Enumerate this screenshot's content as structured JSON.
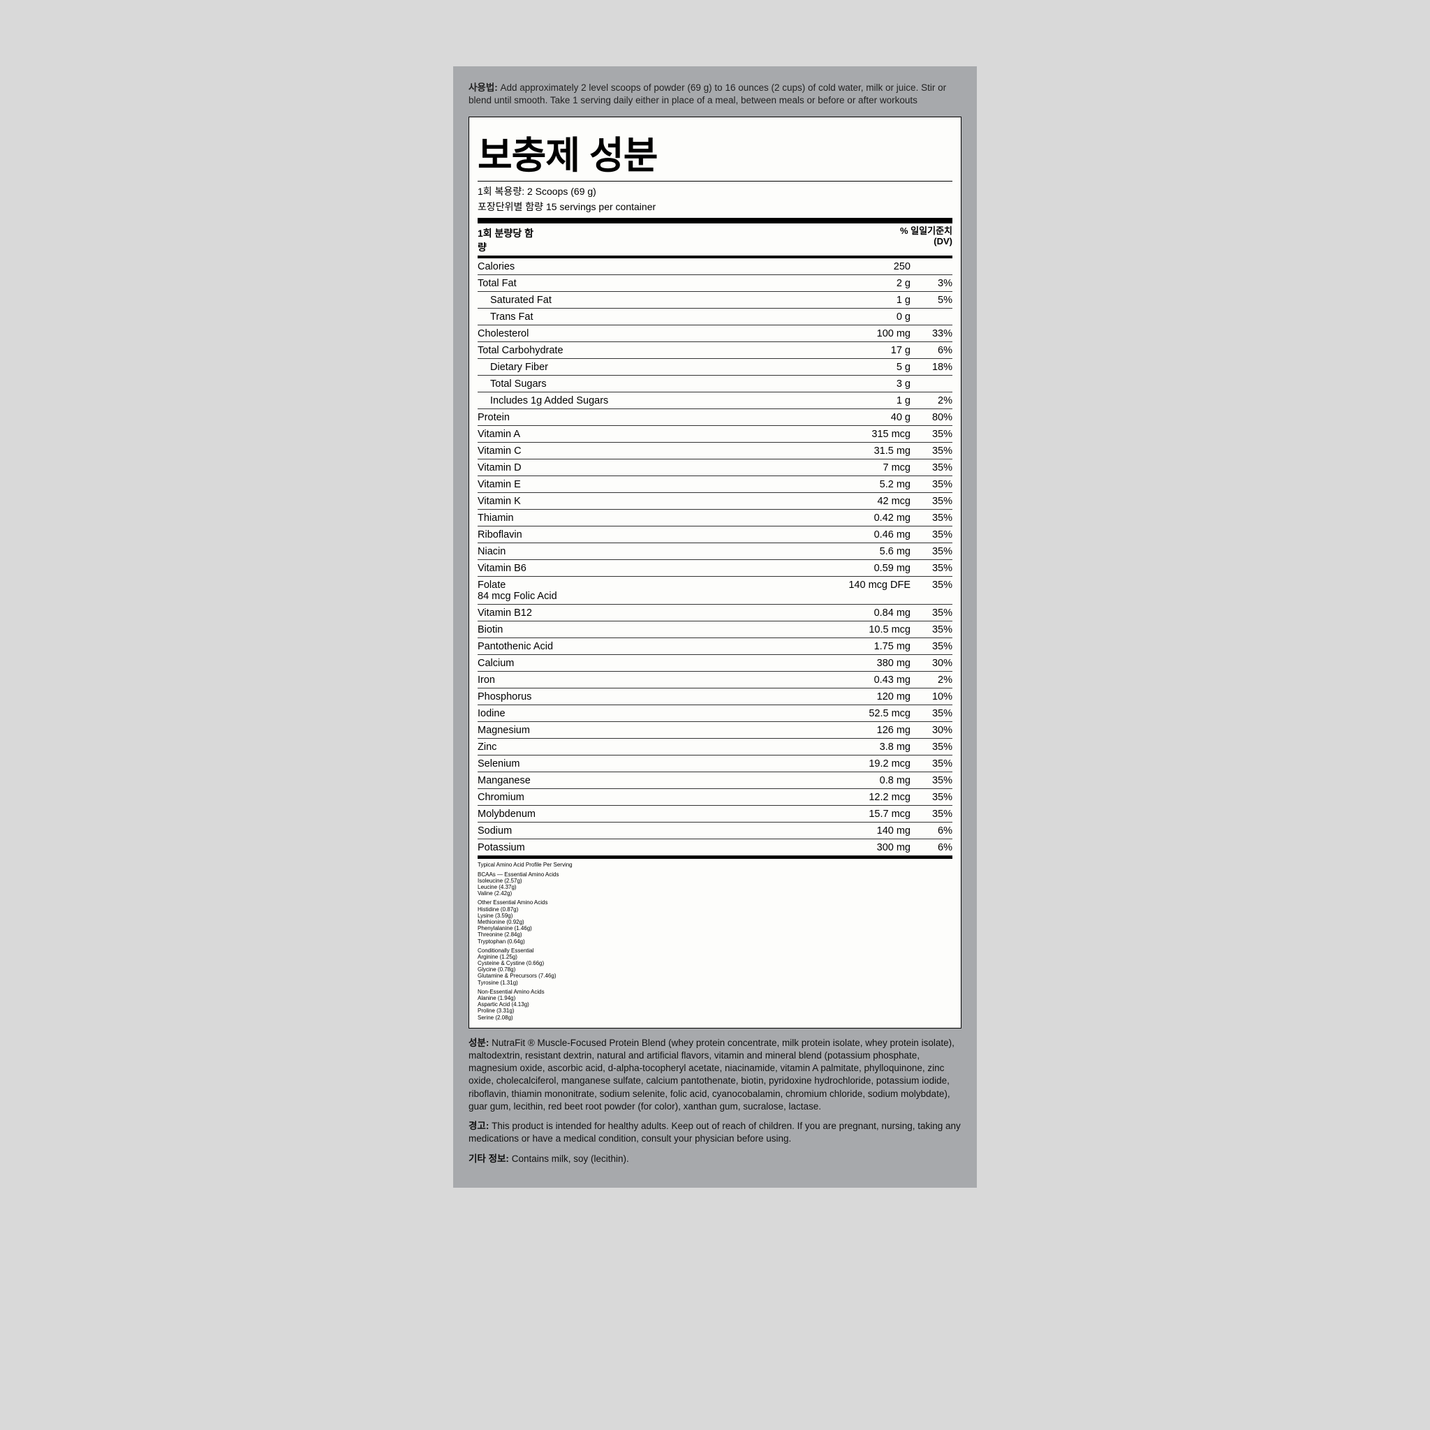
{
  "usage": {
    "label": "사용법:",
    "text": " Add approximately 2 level scoops of powder (69 g) to 16 ounces (2 cups) of cold water, milk or juice. Stir or blend until smooth. Take 1 serving daily either in place of a meal, between meals or before or after workouts"
  },
  "title": "보충제 성분",
  "serving_size_label": "1회 복용량: ",
  "serving_size": "2 Scoops (69 g)",
  "servings_per_label": "포장단위별 함량 ",
  "servings_per": "15 servings per container",
  "col_left": "1회 분량당 함량",
  "col_right": "% 일일기준치 (DV)",
  "rows": [
    {
      "name": "Calories",
      "amt": "250",
      "dv": ""
    },
    {
      "name": "Total Fat",
      "amt": "2 g",
      "dv": "3%"
    },
    {
      "name": "Saturated Fat",
      "amt": "1 g",
      "dv": "5%",
      "sub": true
    },
    {
      "name": "Trans Fat",
      "amt": "0 g",
      "dv": "",
      "sub": true
    },
    {
      "name": "Cholesterol",
      "amt": "100 mg",
      "dv": "33%"
    },
    {
      "name": "Total Carbohydrate",
      "amt": "17 g",
      "dv": "6%"
    },
    {
      "name": "Dietary Fiber",
      "amt": "5 g",
      "dv": "18%",
      "sub": true
    },
    {
      "name": "Total Sugars",
      "amt": "3 g",
      "dv": "",
      "sub": true
    },
    {
      "name": "Includes 1g Added Sugars",
      "amt": "1 g",
      "dv": "2%",
      "sub": true
    },
    {
      "name": "Protein",
      "amt": "40 g",
      "dv": "80%"
    },
    {
      "name": "Vitamin A",
      "amt": "315 mcg",
      "dv": "35%"
    },
    {
      "name": "Vitamin C",
      "amt": "31.5 mg",
      "dv": "35%"
    },
    {
      "name": "Vitamin D",
      "amt": "7 mcg",
      "dv": "35%"
    },
    {
      "name": "Vitamin E",
      "amt": "5.2 mg",
      "dv": "35%"
    },
    {
      "name": "Vitamin K",
      "amt": "42 mcg",
      "dv": "35%"
    },
    {
      "name": "Thiamin",
      "amt": "0.42 mg",
      "dv": "35%"
    },
    {
      "name": "Riboflavin",
      "amt": "0.46 mg",
      "dv": "35%"
    },
    {
      "name": "Niacin",
      "amt": "5.6 mg",
      "dv": "35%"
    },
    {
      "name": "Vitamin B6",
      "amt": "0.59 mg",
      "dv": "35%"
    },
    {
      "name": "Folate\n84 mcg Folic Acid",
      "amt": "140 mcg DFE",
      "dv": "35%"
    },
    {
      "name": "Vitamin B12",
      "amt": "0.84 mg",
      "dv": "35%"
    },
    {
      "name": "Biotin",
      "amt": "10.5 mcg",
      "dv": "35%"
    },
    {
      "name": "Pantothenic Acid",
      "amt": "1.75 mg",
      "dv": "35%"
    },
    {
      "name": "Calcium",
      "amt": "380 mg",
      "dv": "30%"
    },
    {
      "name": "Iron",
      "amt": "0.43 mg",
      "dv": "2%"
    },
    {
      "name": "Phosphorus",
      "amt": "120 mg",
      "dv": "10%"
    },
    {
      "name": "Iodine",
      "amt": "52.5 mcg",
      "dv": "35%"
    },
    {
      "name": "Magnesium",
      "amt": "126 mg",
      "dv": "30%"
    },
    {
      "name": "Zinc",
      "amt": "3.8 mg",
      "dv": "35%"
    },
    {
      "name": "Selenium",
      "amt": "19.2 mcg",
      "dv": "35%"
    },
    {
      "name": "Manganese",
      "amt": "0.8 mg",
      "dv": "35%"
    },
    {
      "name": "Chromium",
      "amt": "12.2 mcg",
      "dv": "35%"
    },
    {
      "name": "Molybdenum",
      "amt": "15.7 mcg",
      "dv": "35%"
    },
    {
      "name": "Sodium",
      "amt": "140 mg",
      "dv": "6%"
    },
    {
      "name": "Potassium",
      "amt": "300 mg",
      "dv": "6%"
    }
  ],
  "amino": {
    "head": "Typical Amino Acid Profile Per Serving",
    "groups": [
      {
        "title": "BCAAs — Essential Amino Acids",
        "items": [
          "Isoleucine (2.57g)",
          "Leucine (4.37g)",
          "Valine (2.42g)"
        ]
      },
      {
        "title": "Other Essential Amino Acids",
        "items": [
          "Histidine (0.87g)",
          "Lysine (3.59g)",
          "Methionine (0.92g)",
          "Phenylalanine (1.46g)",
          "Threonine (2.84g)",
          "Tryptophan (0.64g)"
        ]
      },
      {
        "title": "Conditionally Essential",
        "items": [
          "Arginine (1.25g)",
          "Cysteine & Cystine (0.66g)",
          "Glycine (0.78g)",
          "Glutamine & Precursors (7.46g)",
          "Tyrosine (1.31g)"
        ]
      },
      {
        "title": "Non-Essential Amino Acids",
        "items": [
          "Alanine (1.94g)",
          "Aspartic Acid (4.13g)",
          "Proline (3.31g)",
          "Serine (2.08g)"
        ]
      }
    ]
  },
  "ingredients_label": "성분:",
  "ingredients_text": " NutraFit ® Muscle-Focused Protein Blend  (whey protein concentrate, milk protein isolate, whey protein isolate), maltodextrin, resistant dextrin, natural and artificial flavors, vitamin and mineral blend (potassium phosphate, magnesium oxide, ascorbic acid, d-alpha-tocopheryl acetate, niacinamide, vitamin A palmitate, phylloquinone, zinc oxide, cholecalciferol, manganese sulfate, calcium pantothenate, biotin, pyridoxine hydrochloride, potassium iodide, riboflavin, thiamin mononitrate, sodium selenite, folic acid, cyanocobalamin, chromium chloride, sodium molybdate), guar gum, lecithin, red beet root powder (for color), xanthan gum, sucralose, lactase.",
  "warning_label": "경고:",
  "warning_text": " This product is intended for healthy adults. Keep out of reach of children. If you are pregnant, nursing, taking any medications or have a medical condition, consult your physician before using.",
  "other_label": "기타 정보:",
  "other_text": " Contains milk, soy (lecithin)."
}
